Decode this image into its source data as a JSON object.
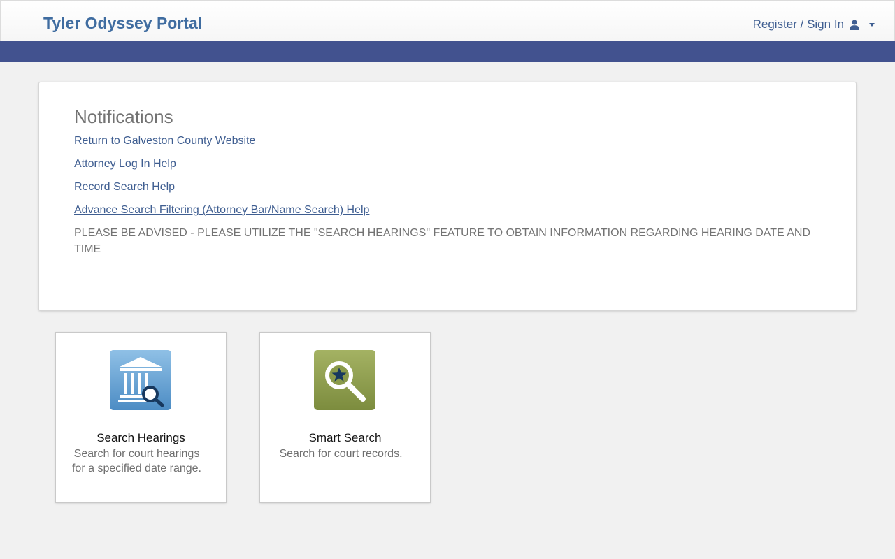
{
  "header": {
    "brand": "Tyler Odyssey Portal",
    "signin_label": "Register / Sign In",
    "user_icon": "user-icon",
    "dropdown_icon": "caret-down-icon"
  },
  "colors": {
    "brand": "#3f6ca0",
    "band": "#42528f",
    "link": "#3f5e91",
    "hearings_tile": "#5a9bd0",
    "smart_search_tile": "#8a9a4a"
  },
  "notifications": {
    "title": "Notifications",
    "links": [
      "Return to Galveston County Website",
      "Attorney Log In Help",
      "Record Search Help",
      "Advance Search Filtering (Attorney Bar/Name Search) Help"
    ],
    "notice": "PLEASE BE ADVISED - PLEASE UTILIZE THE \"SEARCH HEARINGS\" FEATURE TO OBTAIN INFORMATION REGARDING HEARING DATE AND TIME"
  },
  "tiles": [
    {
      "icon": "courthouse-search-icon",
      "title": "Search Hearings",
      "description": "Search for court hearings for a specified date range."
    },
    {
      "icon": "star-magnifier-icon",
      "title": "Smart Search",
      "description": "Search for court records."
    }
  ]
}
